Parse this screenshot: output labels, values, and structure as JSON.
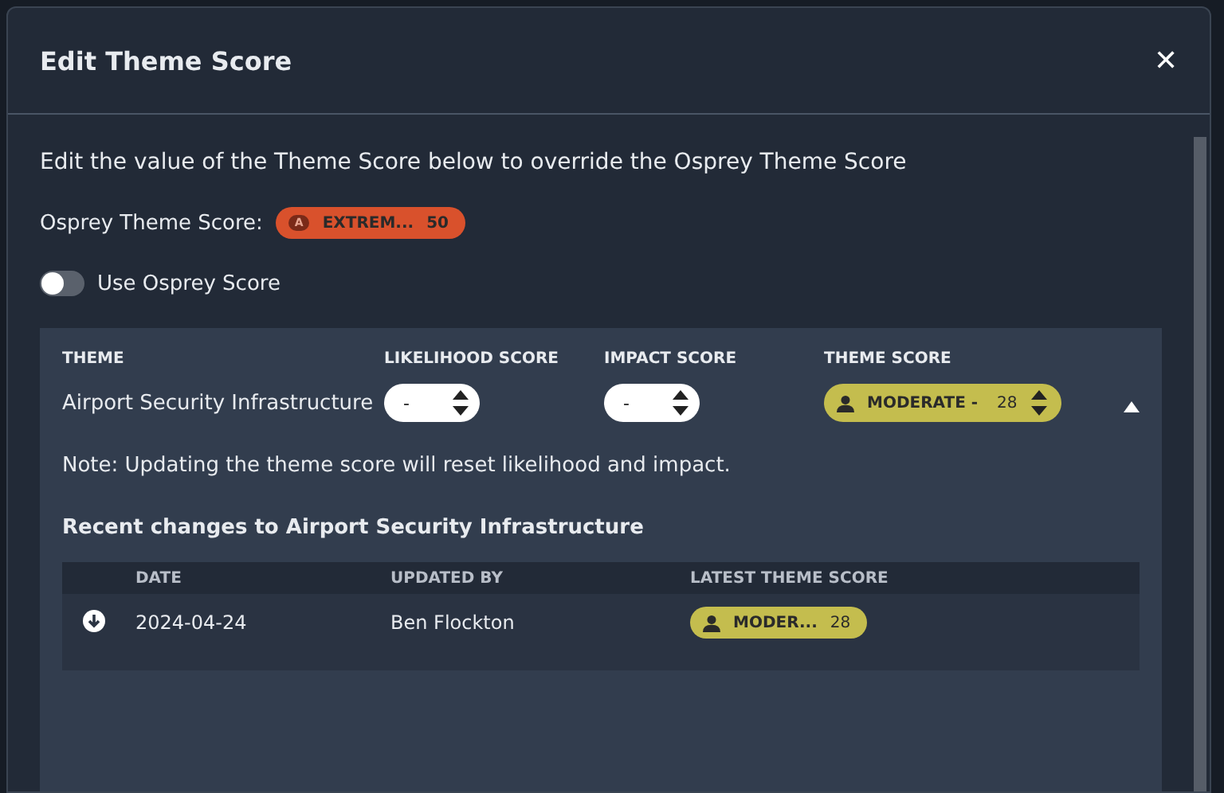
{
  "dialog": {
    "title": "Edit Theme Score",
    "close": "✕"
  },
  "intro": "Edit the value of the Theme Score below to override the Osprey Theme Score",
  "osprey_score": {
    "label": "Osprey Theme Score:",
    "badge": {
      "source": "A",
      "level_text": "EXTREM...",
      "value": "50",
      "color": "#d9512c"
    }
  },
  "use_osprey": {
    "label": "Use Osprey Score",
    "on": false
  },
  "theme_table": {
    "columns": [
      "THEME",
      "LIKELIHOOD SCORE",
      "IMPACT SCORE",
      "THEME SCORE"
    ],
    "row": {
      "theme": "Airport Security Infrastructure",
      "likelihood": "-",
      "impact": "-",
      "score": {
        "level_text": "MODERATE -",
        "value": "28",
        "color": "#c4bd4e"
      },
      "expanded": true
    },
    "note": "Note: Updating the theme score will reset likelihood and impact.",
    "history_title": "Recent changes to Airport Security Infrastructure",
    "history": {
      "columns": [
        "DATE",
        "UPDATED BY",
        "LATEST THEME SCORE"
      ],
      "rows": [
        {
          "date": "2024-04-24",
          "updated_by": "Ben Flockton",
          "score": {
            "level_text": "MODER...",
            "value": "28",
            "color": "#c4bd4e"
          }
        }
      ]
    }
  }
}
